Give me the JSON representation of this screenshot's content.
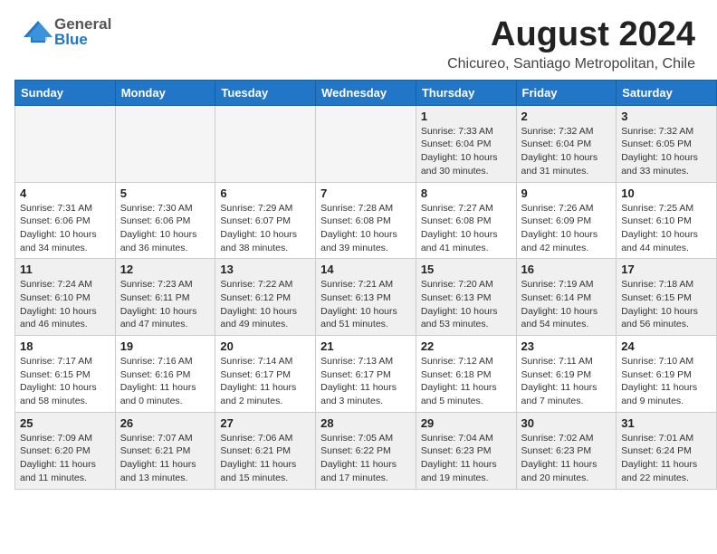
{
  "header": {
    "logo": {
      "text1": "General",
      "text2": "Blue"
    },
    "title": "August 2024",
    "location": "Chicureo, Santiago Metropolitan, Chile"
  },
  "weekdays": [
    "Sunday",
    "Monday",
    "Tuesday",
    "Wednesday",
    "Thursday",
    "Friday",
    "Saturday"
  ],
  "weeks": [
    [
      {
        "day": "",
        "empty": true
      },
      {
        "day": "",
        "empty": true
      },
      {
        "day": "",
        "empty": true
      },
      {
        "day": "",
        "empty": true
      },
      {
        "day": "1",
        "info": "Sunrise: 7:33 AM\nSunset: 6:04 PM\nDaylight: 10 hours\nand 30 minutes."
      },
      {
        "day": "2",
        "info": "Sunrise: 7:32 AM\nSunset: 6:04 PM\nDaylight: 10 hours\nand 31 minutes."
      },
      {
        "day": "3",
        "info": "Sunrise: 7:32 AM\nSunset: 6:05 PM\nDaylight: 10 hours\nand 33 minutes."
      }
    ],
    [
      {
        "day": "4",
        "info": "Sunrise: 7:31 AM\nSunset: 6:06 PM\nDaylight: 10 hours\nand 34 minutes."
      },
      {
        "day": "5",
        "info": "Sunrise: 7:30 AM\nSunset: 6:06 PM\nDaylight: 10 hours\nand 36 minutes."
      },
      {
        "day": "6",
        "info": "Sunrise: 7:29 AM\nSunset: 6:07 PM\nDaylight: 10 hours\nand 38 minutes."
      },
      {
        "day": "7",
        "info": "Sunrise: 7:28 AM\nSunset: 6:08 PM\nDaylight: 10 hours\nand 39 minutes."
      },
      {
        "day": "8",
        "info": "Sunrise: 7:27 AM\nSunset: 6:08 PM\nDaylight: 10 hours\nand 41 minutes."
      },
      {
        "day": "9",
        "info": "Sunrise: 7:26 AM\nSunset: 6:09 PM\nDaylight: 10 hours\nand 42 minutes."
      },
      {
        "day": "10",
        "info": "Sunrise: 7:25 AM\nSunset: 6:10 PM\nDaylight: 10 hours\nand 44 minutes."
      }
    ],
    [
      {
        "day": "11",
        "info": "Sunrise: 7:24 AM\nSunset: 6:10 PM\nDaylight: 10 hours\nand 46 minutes."
      },
      {
        "day": "12",
        "info": "Sunrise: 7:23 AM\nSunset: 6:11 PM\nDaylight: 10 hours\nand 47 minutes."
      },
      {
        "day": "13",
        "info": "Sunrise: 7:22 AM\nSunset: 6:12 PM\nDaylight: 10 hours\nand 49 minutes."
      },
      {
        "day": "14",
        "info": "Sunrise: 7:21 AM\nSunset: 6:13 PM\nDaylight: 10 hours\nand 51 minutes."
      },
      {
        "day": "15",
        "info": "Sunrise: 7:20 AM\nSunset: 6:13 PM\nDaylight: 10 hours\nand 53 minutes."
      },
      {
        "day": "16",
        "info": "Sunrise: 7:19 AM\nSunset: 6:14 PM\nDaylight: 10 hours\nand 54 minutes."
      },
      {
        "day": "17",
        "info": "Sunrise: 7:18 AM\nSunset: 6:15 PM\nDaylight: 10 hours\nand 56 minutes."
      }
    ],
    [
      {
        "day": "18",
        "info": "Sunrise: 7:17 AM\nSunset: 6:15 PM\nDaylight: 10 hours\nand 58 minutes."
      },
      {
        "day": "19",
        "info": "Sunrise: 7:16 AM\nSunset: 6:16 PM\nDaylight: 11 hours\nand 0 minutes."
      },
      {
        "day": "20",
        "info": "Sunrise: 7:14 AM\nSunset: 6:17 PM\nDaylight: 11 hours\nand 2 minutes."
      },
      {
        "day": "21",
        "info": "Sunrise: 7:13 AM\nSunset: 6:17 PM\nDaylight: 11 hours\nand 3 minutes."
      },
      {
        "day": "22",
        "info": "Sunrise: 7:12 AM\nSunset: 6:18 PM\nDaylight: 11 hours\nand 5 minutes."
      },
      {
        "day": "23",
        "info": "Sunrise: 7:11 AM\nSunset: 6:19 PM\nDaylight: 11 hours\nand 7 minutes."
      },
      {
        "day": "24",
        "info": "Sunrise: 7:10 AM\nSunset: 6:19 PM\nDaylight: 11 hours\nand 9 minutes."
      }
    ],
    [
      {
        "day": "25",
        "info": "Sunrise: 7:09 AM\nSunset: 6:20 PM\nDaylight: 11 hours\nand 11 minutes."
      },
      {
        "day": "26",
        "info": "Sunrise: 7:07 AM\nSunset: 6:21 PM\nDaylight: 11 hours\nand 13 minutes."
      },
      {
        "day": "27",
        "info": "Sunrise: 7:06 AM\nSunset: 6:21 PM\nDaylight: 11 hours\nand 15 minutes."
      },
      {
        "day": "28",
        "info": "Sunrise: 7:05 AM\nSunset: 6:22 PM\nDaylight: 11 hours\nand 17 minutes."
      },
      {
        "day": "29",
        "info": "Sunrise: 7:04 AM\nSunset: 6:23 PM\nDaylight: 11 hours\nand 19 minutes."
      },
      {
        "day": "30",
        "info": "Sunrise: 7:02 AM\nSunset: 6:23 PM\nDaylight: 11 hours\nand 20 minutes."
      },
      {
        "day": "31",
        "info": "Sunrise: 7:01 AM\nSunset: 6:24 PM\nDaylight: 11 hours\nand 22 minutes."
      }
    ]
  ]
}
